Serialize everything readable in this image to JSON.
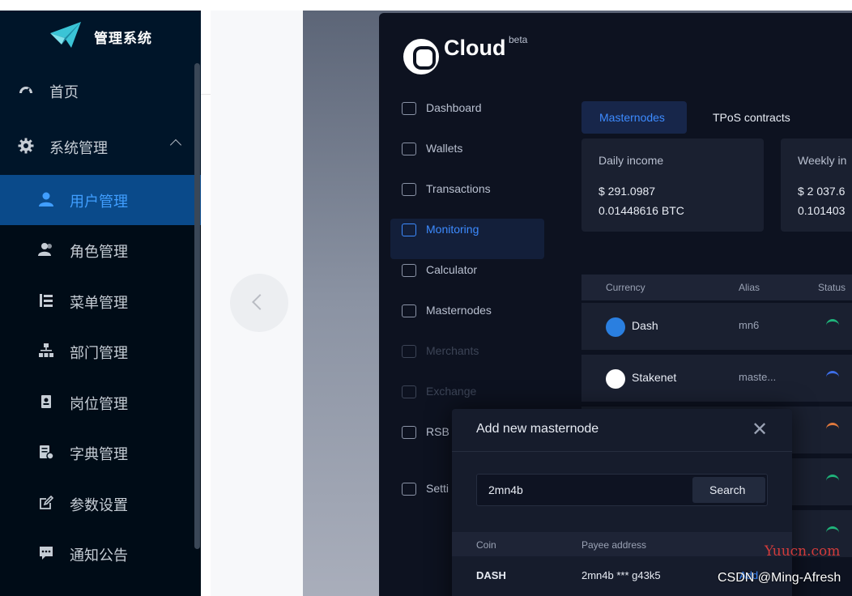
{
  "sidebar": {
    "title": "管理系统",
    "items": [
      {
        "label": "首页",
        "icon": "dashboard-icon"
      },
      {
        "label": "系统管理",
        "icon": "gear-icon"
      },
      {
        "label": "用户管理",
        "icon": "user-icon"
      },
      {
        "label": "角色管理",
        "icon": "people-icon"
      },
      {
        "label": "菜单管理",
        "icon": "tree-table-icon"
      },
      {
        "label": "部门管理",
        "icon": "org-tree-icon"
      },
      {
        "label": "岗位管理",
        "icon": "post-icon"
      },
      {
        "label": "字典管理",
        "icon": "dict-icon"
      },
      {
        "label": "参数设置",
        "icon": "edit-icon"
      },
      {
        "label": "通知公告",
        "icon": "message-icon"
      }
    ],
    "accent": "#409eff",
    "background": "#001529"
  },
  "carousel": {
    "prev_icon": "chevron-left-icon"
  },
  "screenshot": {
    "brand": {
      "name": "Cloud",
      "badge": "beta"
    },
    "nav": [
      {
        "label": "Dashboard"
      },
      {
        "label": "Wallets"
      },
      {
        "label": "Transactions"
      },
      {
        "label": "Monitoring"
      },
      {
        "label": "Calculator"
      },
      {
        "label": "Masternodes"
      },
      {
        "label": "Merchants"
      },
      {
        "label": "Exchange"
      },
      {
        "label": "RSB"
      },
      {
        "label": "Setti"
      }
    ],
    "tabs": {
      "masternodes": "Masternodes",
      "tpos": "TPoS contracts"
    },
    "cards": [
      {
        "title": "Daily income",
        "usd": "$ 291.0987",
        "btc": "0.01448616 BTC"
      },
      {
        "title": "Weekly in",
        "usd": "$ 2 037.6",
        "btc": "0.101403"
      }
    ],
    "table": {
      "headers": {
        "currency": "Currency",
        "alias": "Alias",
        "status": "Status"
      },
      "rows": [
        {
          "coin": "Dash",
          "alias": "mn6"
        },
        {
          "coin": "Stakenet",
          "alias": "maste..."
        }
      ]
    },
    "modal": {
      "title": "Add new masternode",
      "input_value": "2mn4b",
      "search_label": "Search",
      "headers": {
        "coin": "Coin",
        "payee": "Payee address"
      },
      "row": {
        "coin": "DASH",
        "payee": "2mn4b *** g43k5",
        "action": "Add"
      }
    }
  },
  "watermarks": {
    "site": "Yuucn.com",
    "author": "CSDN @Ming-Afresh"
  }
}
